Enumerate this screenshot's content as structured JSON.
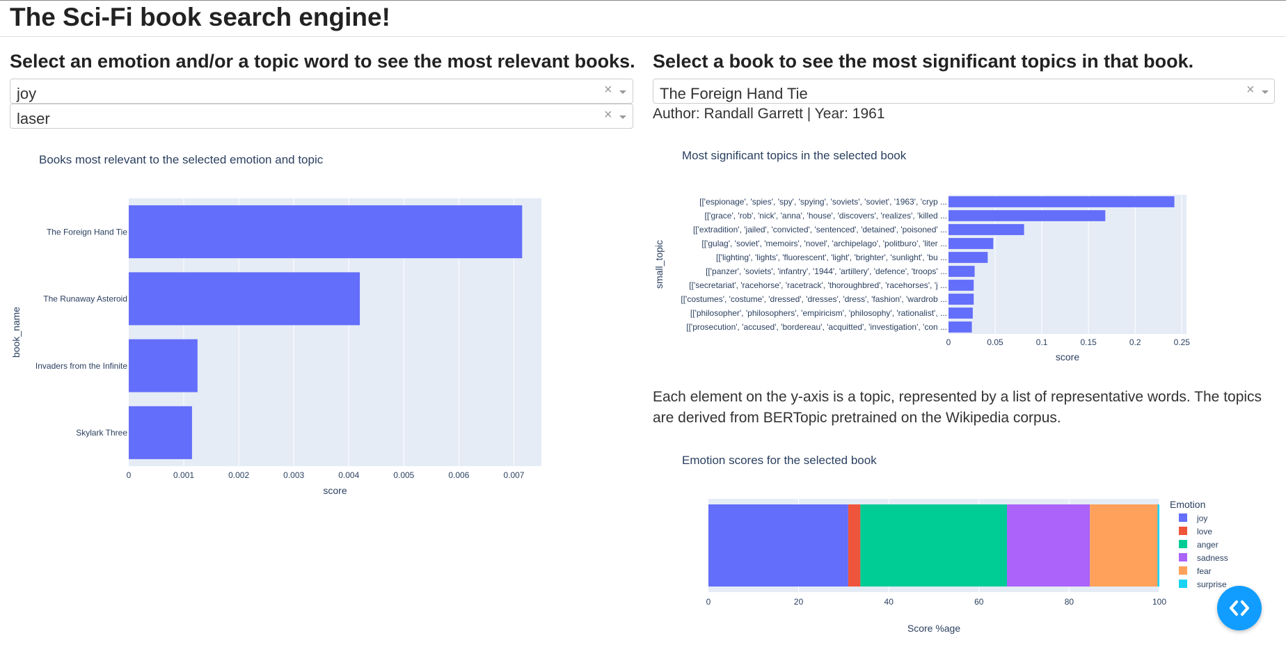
{
  "app": {
    "title": "The Sci-Fi book search engine!"
  },
  "left": {
    "heading": "Select an emotion and/or a topic word to see the most relevant books.",
    "emotion_dropdown": {
      "value": "joy"
    },
    "topic_dropdown": {
      "value": "laser"
    }
  },
  "right": {
    "heading": "Select a book to see the most significant topics in that book.",
    "book_dropdown": {
      "value": "The Foreign Hand Tie"
    },
    "author_line": "Author: Randall Garrett | Year: 1961",
    "explanation": "Each element on the y-axis is a topic, represented by a list of representative words. The topics are derived from BERTopic pretrained on the Wikipedia corpus."
  },
  "icons": {
    "clear": "×",
    "dropdown": "chevron-down-icon",
    "fab": "code-icon"
  },
  "colors": {
    "bar": "#636efa",
    "plot_bg": "#e5ecf6",
    "text": "#2a3f5f",
    "fab": "#119dff",
    "emotions": {
      "joy": "#636efa",
      "love": "#ef553b",
      "anger": "#00cc96",
      "sadness": "#ab63fa",
      "fear": "#ffa15a",
      "surprise": "#19d3f3"
    }
  },
  "chart_data": [
    {
      "type": "bar",
      "orientation": "horizontal",
      "title": "Books most relevant to the selected emotion and topic",
      "xlabel": "score",
      "ylabel": "book_name",
      "categories": [
        "The Foreign Hand Tie",
        "The Runaway Asteroid",
        "Invaders from the Infinite",
        "Skylark Three"
      ],
      "values": [
        0.00715,
        0.0042,
        0.00125,
        0.00115
      ],
      "xlim": [
        0,
        0.0075
      ],
      "xticks": [
        0,
        0.001,
        0.002,
        0.003,
        0.004,
        0.005,
        0.006,
        0.007
      ],
      "xtick_labels": [
        "0",
        "0.001",
        "0.002",
        "0.003",
        "0.004",
        "0.005",
        "0.006",
        "0.007"
      ],
      "grid": true
    },
    {
      "type": "bar",
      "orientation": "horizontal",
      "title": "Most significant topics in the selected book",
      "xlabel": "score",
      "ylabel": "small_topic",
      "categories": [
        "[['espionage', 'spies', 'spy', 'spying', 'soviets', 'soviet', '1963', 'cryp ...",
        "[['grace', 'rob', 'nick', 'anna', 'house', 'discovers', 'realizes', 'killed ...",
        "[['extradition', 'jailed', 'convicted', 'sentenced', 'detained', 'poisoned' ...",
        "[['gulag', 'soviet', 'memoirs', 'novel', 'archipelago', 'politburo', 'liter ...",
        "[['lighting', 'lights', 'fluorescent', 'light', 'brighter', 'sunlight', 'bu ...",
        "[['panzer', 'soviets', 'infantry', '1944', 'artillery', 'defence', 'troops' ...",
        "[['secretariat', 'racehorse', 'racetrack', 'thoroughbred', 'racehorses', 'j ...",
        "[['costumes', 'costume', 'dressed', 'dresses', 'dress', 'fashion', 'wardrob ...",
        "[['philosopher', 'philosophers', 'empiricism', 'philosophy', 'rationalist', ...",
        "[['prosecution', 'accused', 'bordereau', 'acquitted', 'investigation', 'con ..."
      ],
      "values": [
        0.242,
        0.168,
        0.081,
        0.048,
        0.042,
        0.028,
        0.027,
        0.027,
        0.026,
        0.025
      ],
      "xlim": [
        0,
        0.255
      ],
      "xticks": [
        0,
        0.05,
        0.1,
        0.15,
        0.2,
        0.25
      ],
      "xtick_labels": [
        "0",
        "0.05",
        "0.1",
        "0.15",
        "0.2",
        "0.25"
      ],
      "grid": true
    },
    {
      "type": "bar",
      "orientation": "horizontal",
      "stacked": true,
      "title": "Emotion scores for the selected book",
      "xlabel": "Score %age",
      "legend_title": "Emotion",
      "legend_position": "right",
      "series": [
        {
          "name": "joy",
          "value": 31.0
        },
        {
          "name": "love",
          "value": 2.7
        },
        {
          "name": "anger",
          "value": 32.5
        },
        {
          "name": "sadness",
          "value": 18.4
        },
        {
          "name": "fear",
          "value": 15.0
        },
        {
          "name": "surprise",
          "value": 0.4
        }
      ],
      "xlim": [
        0,
        100
      ],
      "xticks": [
        0,
        20,
        40,
        60,
        80,
        100
      ],
      "xtick_labels": [
        "0",
        "20",
        "40",
        "60",
        "80",
        "100"
      ],
      "grid": true
    }
  ]
}
